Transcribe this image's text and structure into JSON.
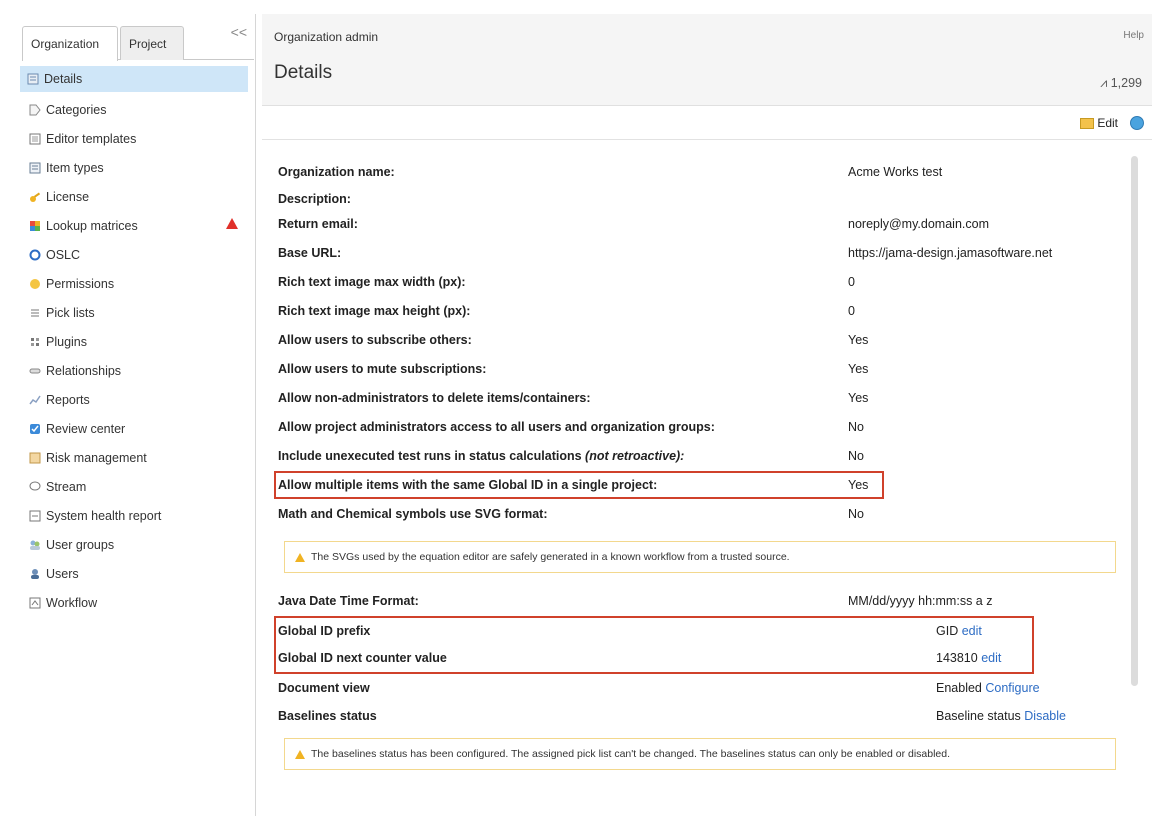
{
  "sidebar": {
    "tabs": [
      "Organization",
      "Project"
    ],
    "collapse_glyph": "<<",
    "items": [
      {
        "label": "Details",
        "icon": "details-icon"
      },
      {
        "label": "Categories",
        "icon": "tag-icon"
      },
      {
        "label": "Editor templates",
        "icon": "template-icon"
      },
      {
        "label": "Item types",
        "icon": "item-types-icon"
      },
      {
        "label": "License",
        "icon": "key-icon"
      },
      {
        "label": "Lookup matrices",
        "icon": "matrix-icon"
      },
      {
        "label": "OSLC",
        "icon": "oslc-icon"
      },
      {
        "label": "Permissions",
        "icon": "permissions-icon"
      },
      {
        "label": "Pick lists",
        "icon": "list-icon"
      },
      {
        "label": "Plugins",
        "icon": "plugin-icon"
      },
      {
        "label": "Relationships",
        "icon": "relationships-icon"
      },
      {
        "label": "Reports",
        "icon": "reports-icon"
      },
      {
        "label": "Review center",
        "icon": "review-icon"
      },
      {
        "label": "Risk management",
        "icon": "risk-icon"
      },
      {
        "label": "Stream",
        "icon": "stream-icon"
      },
      {
        "label": "System health report",
        "icon": "health-icon"
      },
      {
        "label": "User groups",
        "icon": "user-groups-icon"
      },
      {
        "label": "Users",
        "icon": "users-icon"
      },
      {
        "label": "Workflow",
        "icon": "workflow-icon"
      }
    ]
  },
  "header": {
    "breadcrumb": "Organization admin",
    "help": "Help",
    "title": "Details",
    "counter": "1,299",
    "edit_label": "Edit"
  },
  "fields": [
    {
      "label": "Organization name:",
      "value": "Acme Works test"
    },
    {
      "label": "Description:",
      "value": ""
    },
    {
      "label": "Return email:",
      "value": "noreply@my.domain.com"
    },
    {
      "label": "Base URL:",
      "value": "https://jama-design.jamasoftware.net"
    },
    {
      "label": "Rich text image max width (px):",
      "value": "0"
    },
    {
      "label": "Rich text image max height (px):",
      "value": "0"
    },
    {
      "label": "Allow users to subscribe others:",
      "value": "Yes"
    },
    {
      "label": "Allow users to mute subscriptions:",
      "value": "Yes"
    },
    {
      "label": "Allow non-administrators to delete items/containers:",
      "value": "Yes"
    },
    {
      "label": "Allow project administrators access to all users and organization groups:",
      "value": "No"
    },
    {
      "label": "Include unexecuted test runs in status calculations",
      "label_note": "(not retroactive):",
      "value": "No"
    },
    {
      "label": "Allow multiple items with the same Global ID in a single project:",
      "value": "Yes"
    },
    {
      "label": "Math and Chemical symbols use SVG format:",
      "value": "No"
    }
  ],
  "svg_note": "The SVGs used by the equation editor are safely generated in a known workflow from a trusted source.",
  "fields2": [
    {
      "label": "Java Date Time Format:",
      "value": "MM/dd/yyyy hh:mm:ss a z"
    },
    {
      "label": "Global ID prefix",
      "value": "GID",
      "link": "edit"
    },
    {
      "label": "Global ID next counter value",
      "value": "143810",
      "link": "edit"
    },
    {
      "label": "Document view",
      "value": "Enabled",
      "link": "Configure"
    },
    {
      "label": "Baselines status",
      "value": "Baseline status",
      "link": "Disable"
    }
  ],
  "baseline_note": "The baselines status has been configured. The assigned pick list can't be changed. The baselines status can only be enabled or disabled.",
  "colors": {
    "highlight": "#d0412b",
    "link": "#2d6cc4",
    "selected": "#cfe6f8"
  }
}
